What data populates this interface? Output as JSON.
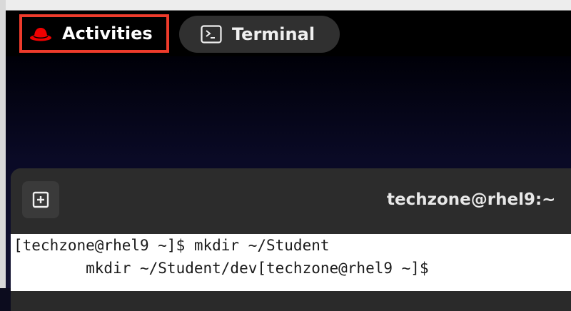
{
  "topbar": {
    "activities_label": "Activities",
    "app_label": "Terminal",
    "activities_highlight_color": "#ee3b2b",
    "logo_icon": "redhat-logo-icon",
    "app_icon": "terminal-icon"
  },
  "window": {
    "title": "techzone@rhel9:~",
    "new_tab_icon": "new-tab-icon"
  },
  "terminal": {
    "line1": "[techzone@rhel9 ~]$ mkdir ~/Student",
    "line2": "        mkdir ~/Student/dev[techzone@rhel9 ~]$"
  }
}
